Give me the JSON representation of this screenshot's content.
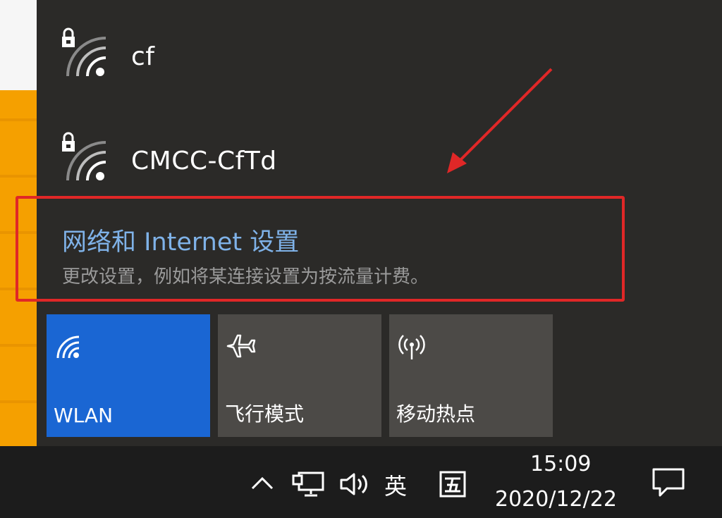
{
  "networks": [
    {
      "ssid": "cf",
      "icon": "wifi-secured-icon"
    },
    {
      "ssid": "CMCC-CfTd",
      "icon": "wifi-secured-icon"
    }
  ],
  "network_settings": {
    "title": "网络和 Internet 设置",
    "description": "更改设置，例如将某连接设置为按流量计费。"
  },
  "quick_actions": [
    {
      "label": "WLAN",
      "icon": "wifi-icon",
      "active": true
    },
    {
      "label": "飞行模式",
      "icon": "airplane-icon",
      "active": false
    },
    {
      "label": "移动热点",
      "icon": "mobile-hotspot-icon",
      "active": false
    }
  ],
  "taskbar": {
    "input_language": "英",
    "time": "15:09",
    "date": "2020/12/22"
  },
  "colors": {
    "accent": "#1a66d3",
    "link": "#7fb2e8",
    "annotation": "#e02727"
  }
}
